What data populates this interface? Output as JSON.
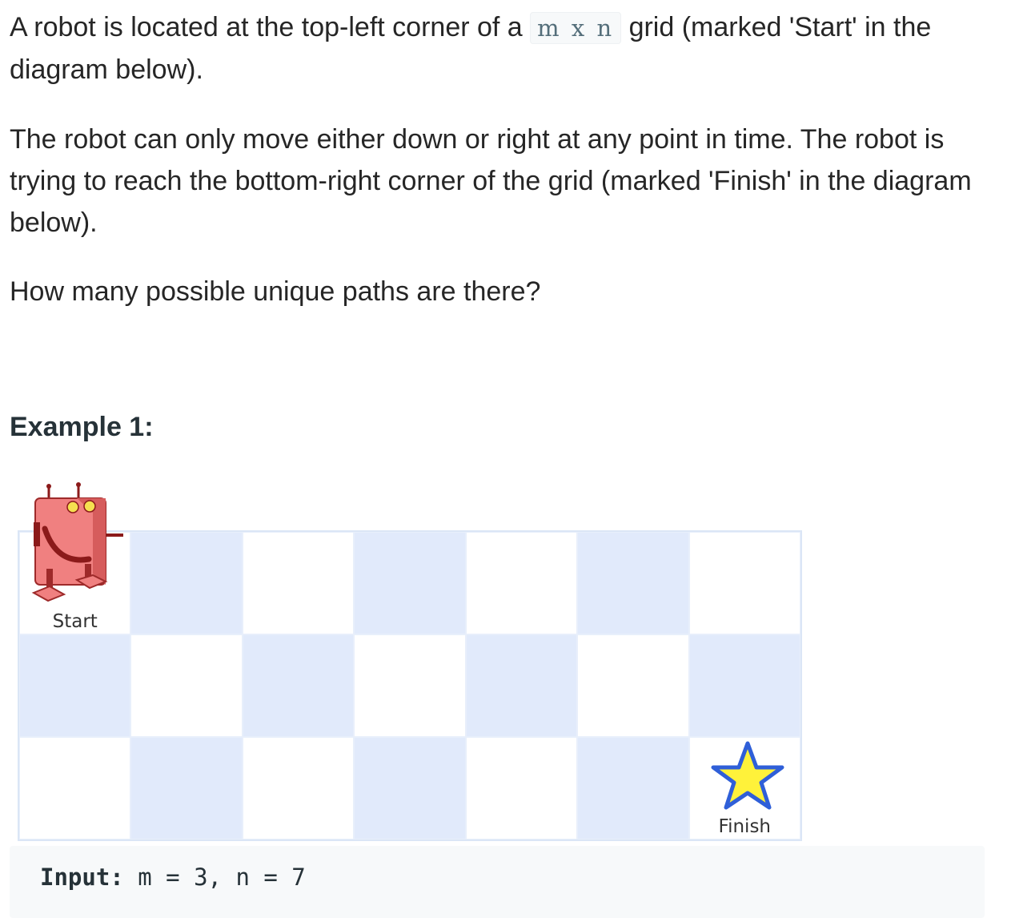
{
  "problem": {
    "p1_before": "A robot is located at the top-left corner of a ",
    "p1_code": "m x n",
    "p1_after": " grid (marked 'Start' in the diagram below).",
    "p2": "The robot can only move either down or right at any point in time. The robot is trying to reach the bottom-right corner of the grid (marked 'Finish' in the diagram below).",
    "p3": "How many possible unique paths are there?"
  },
  "example": {
    "heading": "Example 1:",
    "grid": {
      "rows": 3,
      "cols": 7
    },
    "start_label": "Start",
    "finish_label": "Finish",
    "input_label": "Input:",
    "input_value": " m = 3, n = 7"
  },
  "colors": {
    "shaded_cell": "#e1eafb",
    "star_fill": "#fff23a",
    "star_stroke": "#2f5fd8",
    "robot_body": "#f08080"
  },
  "icons": [
    "robot-icon",
    "star-icon"
  ]
}
